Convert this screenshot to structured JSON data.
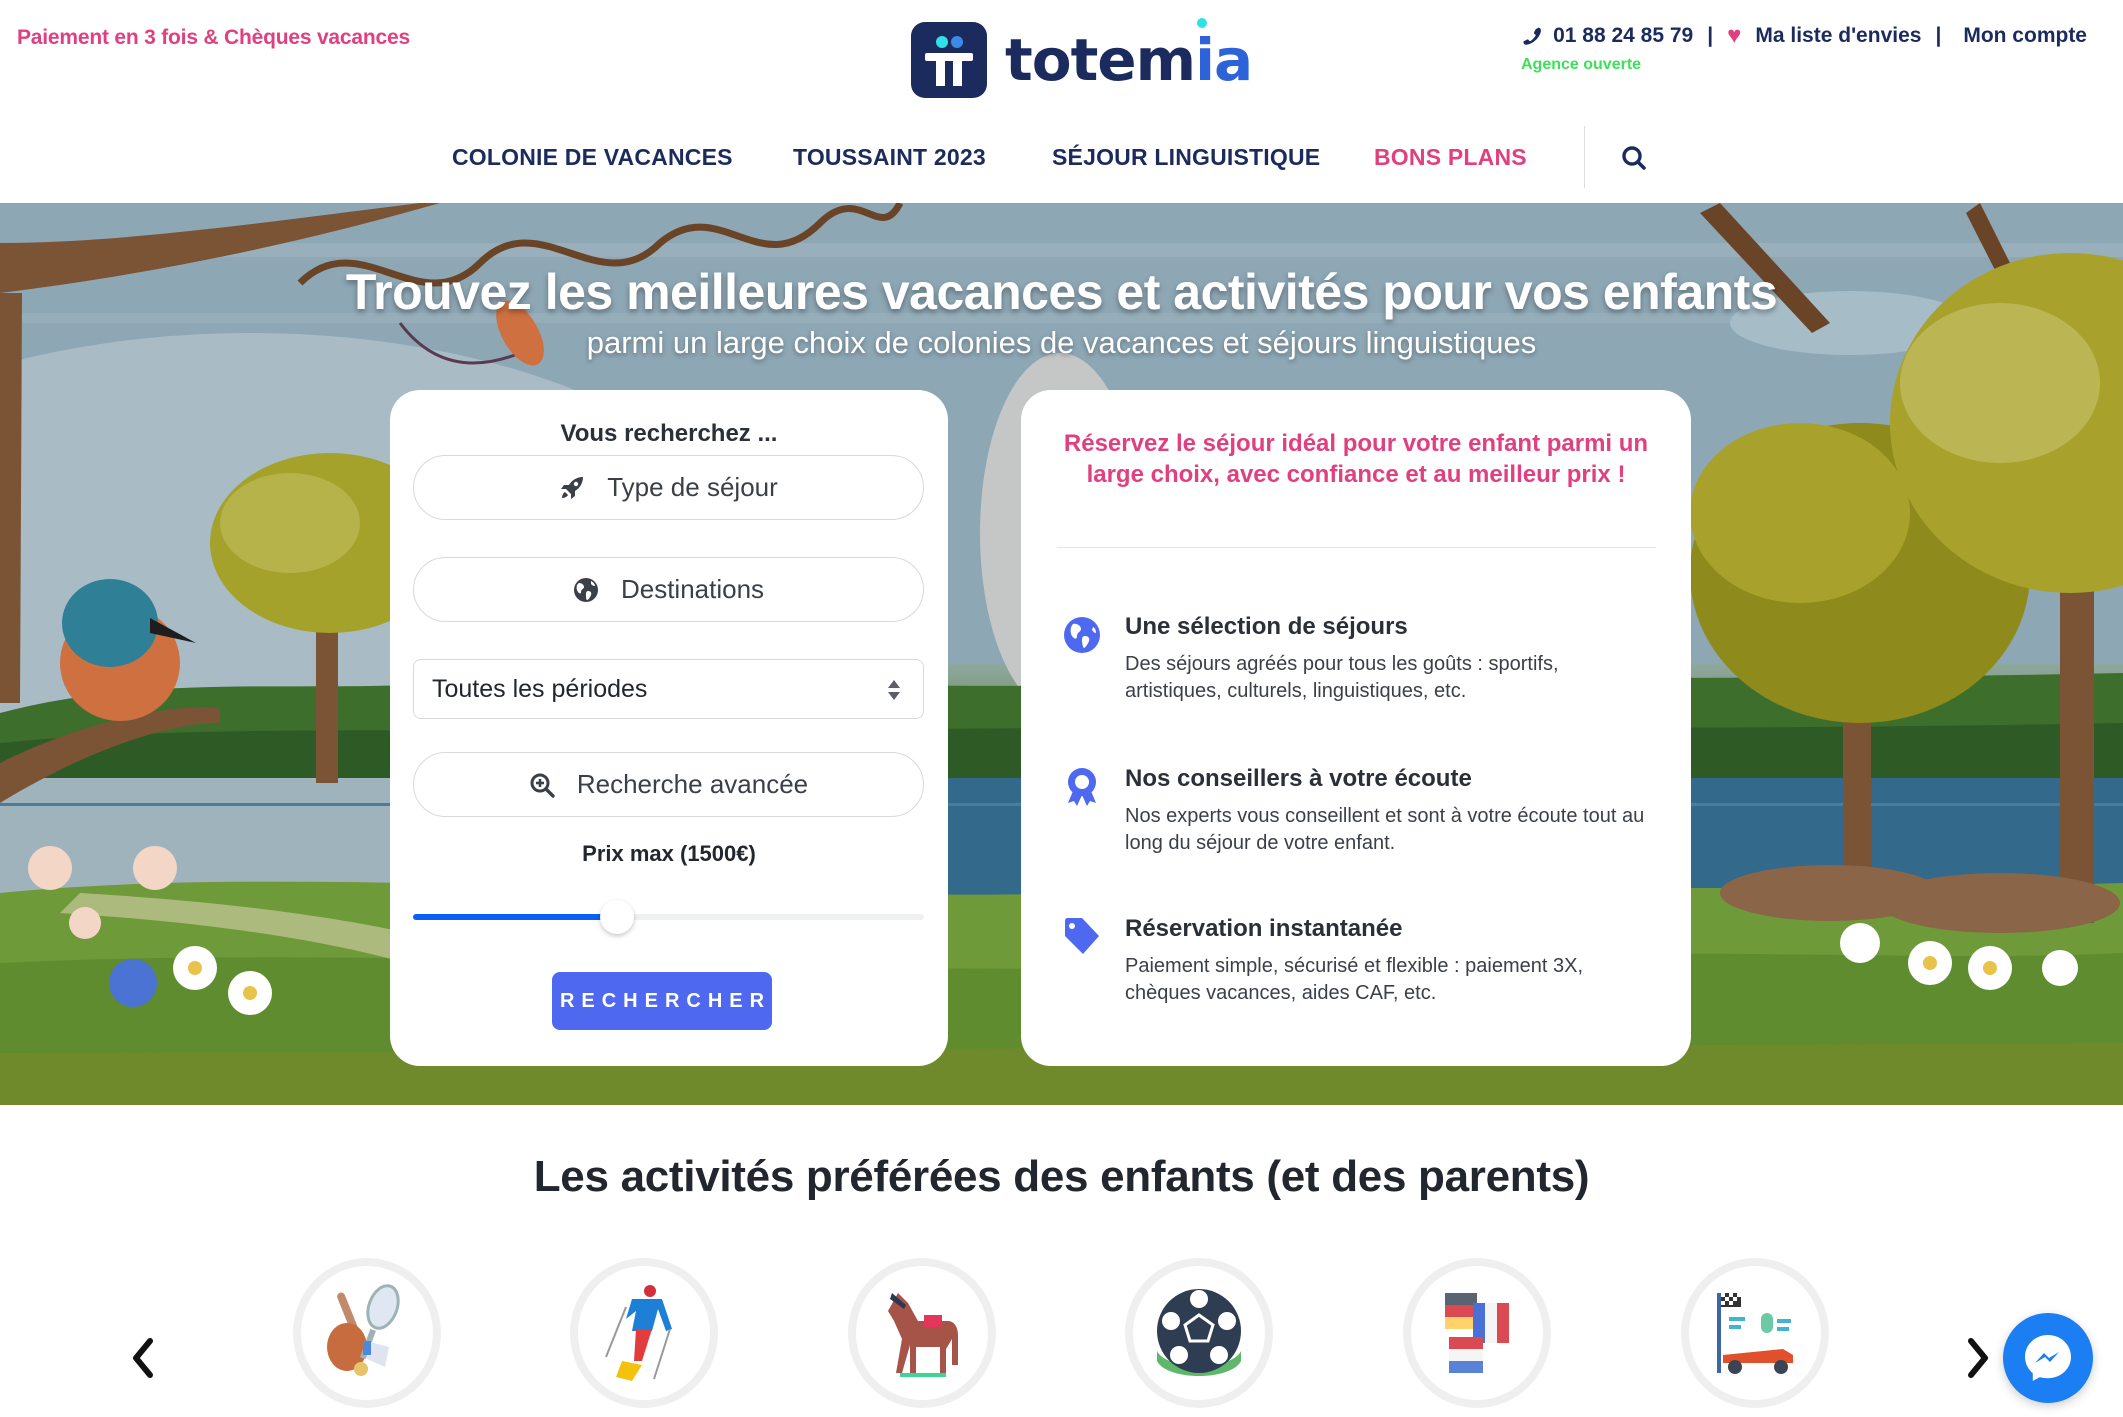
{
  "topbar": {
    "promo": "Paiement en 3 fois & Chèques vacances",
    "brand": {
      "name_main": "totem",
      "name_accent": "ia",
      "logo_colors": {
        "mark_bg": "#1c2b5e",
        "dot1": "#2fe0e8",
        "dot2": "#3d8ae6",
        "accent": "#2e62d9"
      }
    },
    "phone": "01 88 24 85 79",
    "agency_status": "Agence ouverte",
    "wishlist_label": "Ma liste d'envies",
    "account_label": "Mon compte",
    "separator": "|",
    "icons": {
      "phone": "phone-icon",
      "wishlist": "heart-icon"
    }
  },
  "nav": {
    "items": [
      {
        "label": "COLONIE DE VACANCES",
        "highlight": false
      },
      {
        "label": "TOUSSAINT 2023",
        "highlight": false
      },
      {
        "label": "SÉJOUR LINGUISTIQUE",
        "highlight": false
      },
      {
        "label": "BONS PLANS",
        "highlight": true
      }
    ],
    "search_icon": "search-icon"
  },
  "hero": {
    "title": "Trouvez les meilleures vacances et activités pour vos enfants",
    "subtitle": "parmi un large choix de colonies de vacances et séjours linguistiques"
  },
  "search_form": {
    "title": "Vous recherchez ...",
    "type_label": "Type de séjour",
    "destinations_label": "Destinations",
    "period_selected": "Toutes les périodes",
    "advanced_label": "Recherche avancée",
    "price_label": "Prix max (1500€)",
    "price_max_value": 1500,
    "price_slider_fraction": 0.4,
    "submit_label": "RECHERCHER",
    "icons": {
      "type": "rocket-icon",
      "destinations": "globe-icon",
      "period": "sort-arrows-icon",
      "advanced": "zoom-in-icon"
    }
  },
  "info_card": {
    "headline": "Réservez le séjour idéal pour votre enfant parmi un large choix, avec confiance et au meilleur prix !",
    "features": [
      {
        "icon": "globe-americas-icon",
        "title": "Une sélection de séjours",
        "desc": "Des séjours agréés pour tous les goûts : sportifs, artistiques, culturels, linguistiques, etc."
      },
      {
        "icon": "award-ribbon-icon",
        "title": "Nos conseillers à votre écoute",
        "desc": "Nos experts vous conseillent et sont à votre écoute tout au long du séjour de votre enfant."
      },
      {
        "icon": "price-tag-icon",
        "title": "Réservation instantanée",
        "desc": "Paiement simple, sécurisé et flexible : paiement 3X, chèques vacances, aides CAF, etc."
      }
    ]
  },
  "activities": {
    "title": "Les activités préférées des enfants (et des parents)",
    "items": [
      {
        "icon": "racket-sports-icon"
      },
      {
        "icon": "skiing-icon"
      },
      {
        "icon": "horse-riding-icon"
      },
      {
        "icon": "soccer-ball-icon"
      },
      {
        "icon": "languages-flags-icon"
      },
      {
        "icon": "karting-icon"
      }
    ],
    "prev_icon": "chevron-left-icon",
    "next_icon": "chevron-right-icon"
  },
  "chat": {
    "icon": "messenger-icon",
    "color": "#1b7ef2"
  },
  "colors": {
    "pink": "#e0407f",
    "navy": "#1c2b5e",
    "green_status": "#3ee05a",
    "button_blue": "#4f68f0",
    "slider_blue": "#0d5ef2",
    "feature_icon_blue": "#4f68f0"
  }
}
